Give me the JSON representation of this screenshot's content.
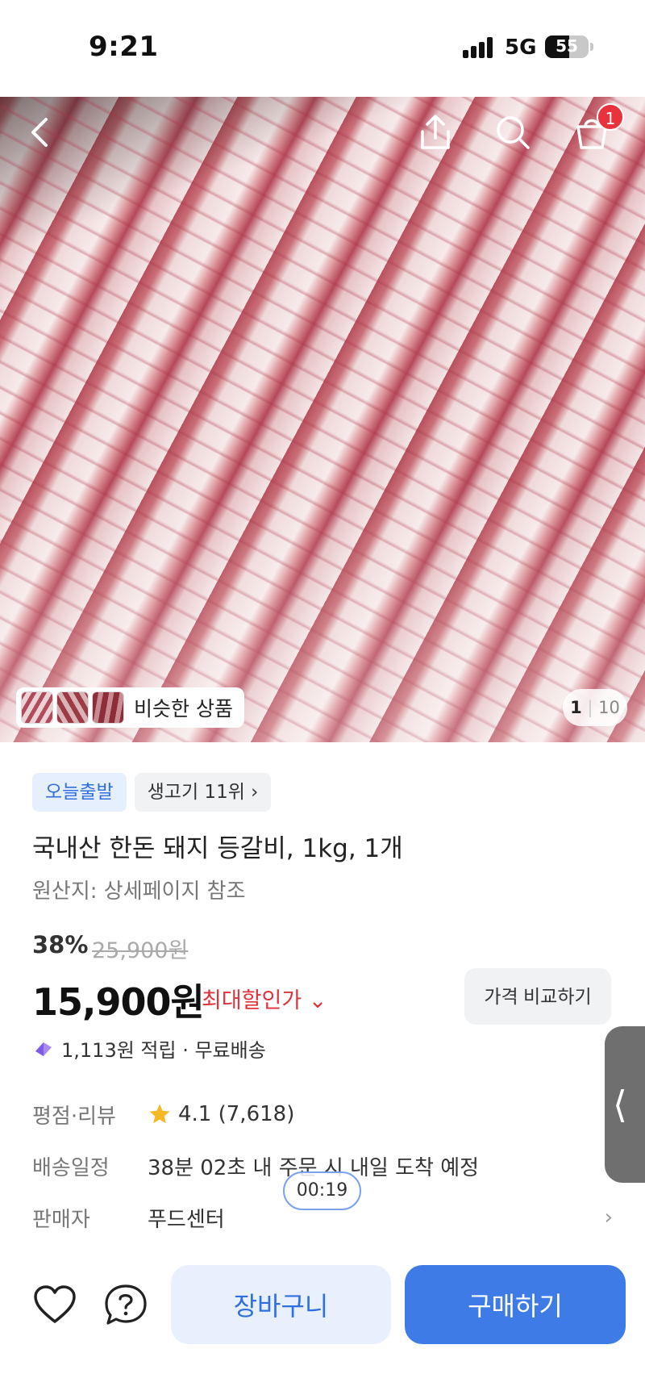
{
  "status_bar": {
    "time": "9:21",
    "network": "5G",
    "battery": "55",
    "battery_level": 0.55
  },
  "top_nav": {
    "cart_count": "1",
    "back_icon": "back-arrow-icon",
    "share_icon": "share-icon",
    "search_icon": "search-icon",
    "cart_icon": "cart-icon"
  },
  "gallery": {
    "similar_label": "비슷한 상품",
    "current": "1",
    "total": "10"
  },
  "tags": {
    "today": "오늘출발",
    "rank": "생고기 11위 ›"
  },
  "product": {
    "title": "국내산 한돈 돼지 등갈비, 1kg, 1개",
    "origin": "원산지: 상세페이지 참조",
    "discount": "38%",
    "original_price": "25,900원",
    "price": "15,900원",
    "max_discount": "최대할인가 ⌄",
    "compare_label": "가격 비교하기",
    "points": "1,113원 적립 · 무료배송"
  },
  "info": {
    "rating_key": "평점·리뷰",
    "rating_value": "4.1 (7,618)",
    "delivery_key": "배송일정",
    "delivery_value": "38분 02초 내 주문 시 내일 도착 예정",
    "seller_key": "판매자",
    "seller_value": "푸드센터"
  },
  "timer": "00:19",
  "side_tab": "⟨",
  "bottom": {
    "cart_button": "장바구니",
    "buy_button": "구매하기"
  },
  "colors": {
    "accent": "#3e7be6",
    "accent_light": "#e9f0fd",
    "sale_red": "#e0323a",
    "badge_red": "#e8323c"
  }
}
